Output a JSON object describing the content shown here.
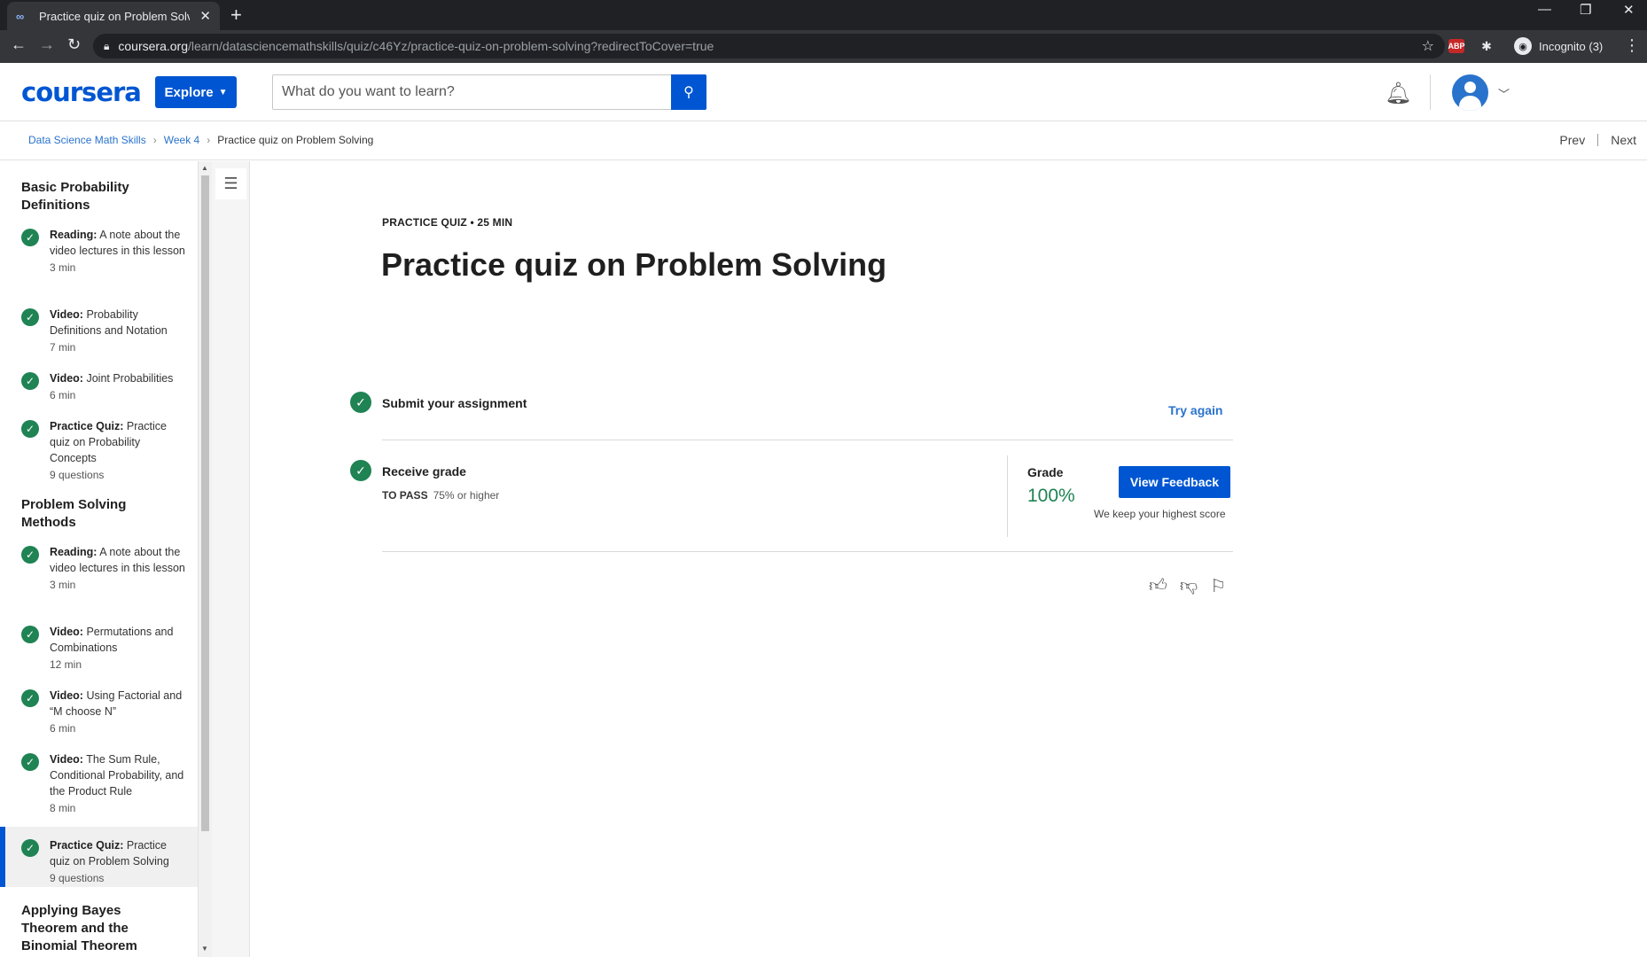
{
  "browser": {
    "tab_title": "Practice quiz on Problem Solving",
    "url_host": "coursera.org",
    "url_path": "/learn/datasciencemathskills/quiz/c46Yz/practice-quiz-on-problem-solving?redirectToCover=true",
    "profile_label": "Incognito (3)",
    "ext_abp": "ABP"
  },
  "header": {
    "logo": "coursera",
    "explore_label": "Explore",
    "search_placeholder": "What do you want to learn?"
  },
  "breadcrumb": {
    "items": [
      "Data Science Math Skills",
      "Week 4"
    ],
    "current": "Practice quiz on Problem Solving",
    "prev": "Prev",
    "next": "Next"
  },
  "sidebar": {
    "sections": [
      {
        "title": "Basic Probability Definitions",
        "items": [
          {
            "type": "Reading:",
            "name": "A note about the video lectures in this lesson",
            "meta": "3 min"
          },
          {
            "type": "Video:",
            "name": "Probability Definitions and Notation",
            "meta": "7 min"
          },
          {
            "type": "Video:",
            "name": "Joint Probabilities",
            "meta": "6 min"
          },
          {
            "type": "Practice Quiz:",
            "name": "Practice quiz on Probability Concepts",
            "meta": "9 questions"
          }
        ]
      },
      {
        "title": "Problem Solving Methods",
        "items": [
          {
            "type": "Reading:",
            "name": "A note about the video lectures in this lesson",
            "meta": "3 min"
          },
          {
            "type": "Video:",
            "name": "Permutations and Combinations",
            "meta": "12 min"
          },
          {
            "type": "Video:",
            "name": "Using Factorial and “M choose N”",
            "meta": "6 min"
          },
          {
            "type": "Video:",
            "name": "The Sum Rule, Conditional Probability, and the Product Rule",
            "meta": "8 min"
          },
          {
            "type": "Practice Quiz:",
            "name": "Practice quiz on Problem Solving",
            "meta": "9 questions"
          }
        ]
      },
      {
        "title": "Applying Bayes Theorem and the Binomial Theorem",
        "items": []
      }
    ]
  },
  "main": {
    "kicker": "PRACTICE QUIZ • 25 MIN",
    "title": "Practice quiz on Problem Solving",
    "step1_label": "Submit your assignment",
    "try_again": "Try again",
    "step2_label": "Receive grade",
    "to_pass_label": "TO PASS",
    "to_pass_value": "75% or higher",
    "grade_label": "Grade",
    "grade_value": "100%",
    "view_feedback": "View Feedback",
    "keep_note": "We keep your highest score"
  },
  "colors": {
    "brand": "#0056d2",
    "success": "#1f8354",
    "link": "#2a73cc"
  }
}
